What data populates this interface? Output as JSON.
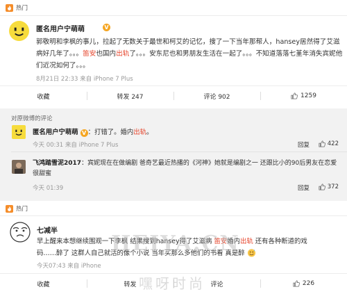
{
  "hot_label": "热门",
  "post1": {
    "user": "匿名用户宁萌萌",
    "text_a": "郭敬明和李枫的事儿，拉起了无数关于最世和柯艾的记忆，搜了一下当年那帮人，hansey居然得了艾滋病好几年了。。。",
    "hl_1": "笛安",
    "text_b": "也国内",
    "hl_2": "出轨",
    "text_c": "了。。。安东尼也和男朋友生活在一起了。。。不知道落落七堇年消失宾妮他们近况如何了。。。",
    "meta": "8月21日 22:33 来自 iPhone 7 Plus",
    "actions": {
      "favorite": "收藏",
      "repost": "转发 247",
      "comment": "评论 902",
      "like": "1259"
    }
  },
  "comments": {
    "title": "对原微博的评论",
    "items": [
      {
        "user": "匿名用户宁萌萌",
        "text_pre": "：打错了。婚内",
        "text_hl": "出轨",
        "text_post": "。",
        "meta": "今天 00:31 来自 iPhone 7 Plus",
        "reply": "回复",
        "likes": "422"
      },
      {
        "user": "飞鸿踏雪泥2017",
        "text": "：宾妮现在在做编剧 爸奇艺最近热播的《河神》她就是编剧之一 还跟比小的90后男友在恋爱很甜蜜",
        "line1": "：宾妮现在在做编剧 爸奇艺最近热播的《河神》她就是编剧之一 还跟比小的90后男友在恋爱",
        "line2": "很甜蜜",
        "meta": "今天 01:39",
        "reply": "回复",
        "likes": "372"
      }
    ]
  },
  "post2": {
    "user": "七减半",
    "line1_a": "早上醒来本想继续围观一下李枫 结果搜到hansey得了艾滋病 ",
    "line1_hl1": "笛安",
    "line1_b": "婚内",
    "line1_hl2": "出轨",
    "line1_c": " 还有各种断道的戏",
    "line2": "码……醉了 这群人自己就活的像个小说 当年买那么多他们的书看 真是醉",
    "meta": "今天07:43 来自 iPhone",
    "actions": {
      "favorite": "收藏",
      "repost": "转发",
      "comment": "评论",
      "like": "226"
    }
  },
  "watermark": "HEIYA.CN",
  "watermark_cn": "嘿呀时尚",
  "colors": {
    "highlight": "#e6452c",
    "accent_orange": "#f5a623",
    "avatar_yellow": "#f7dc3c"
  }
}
